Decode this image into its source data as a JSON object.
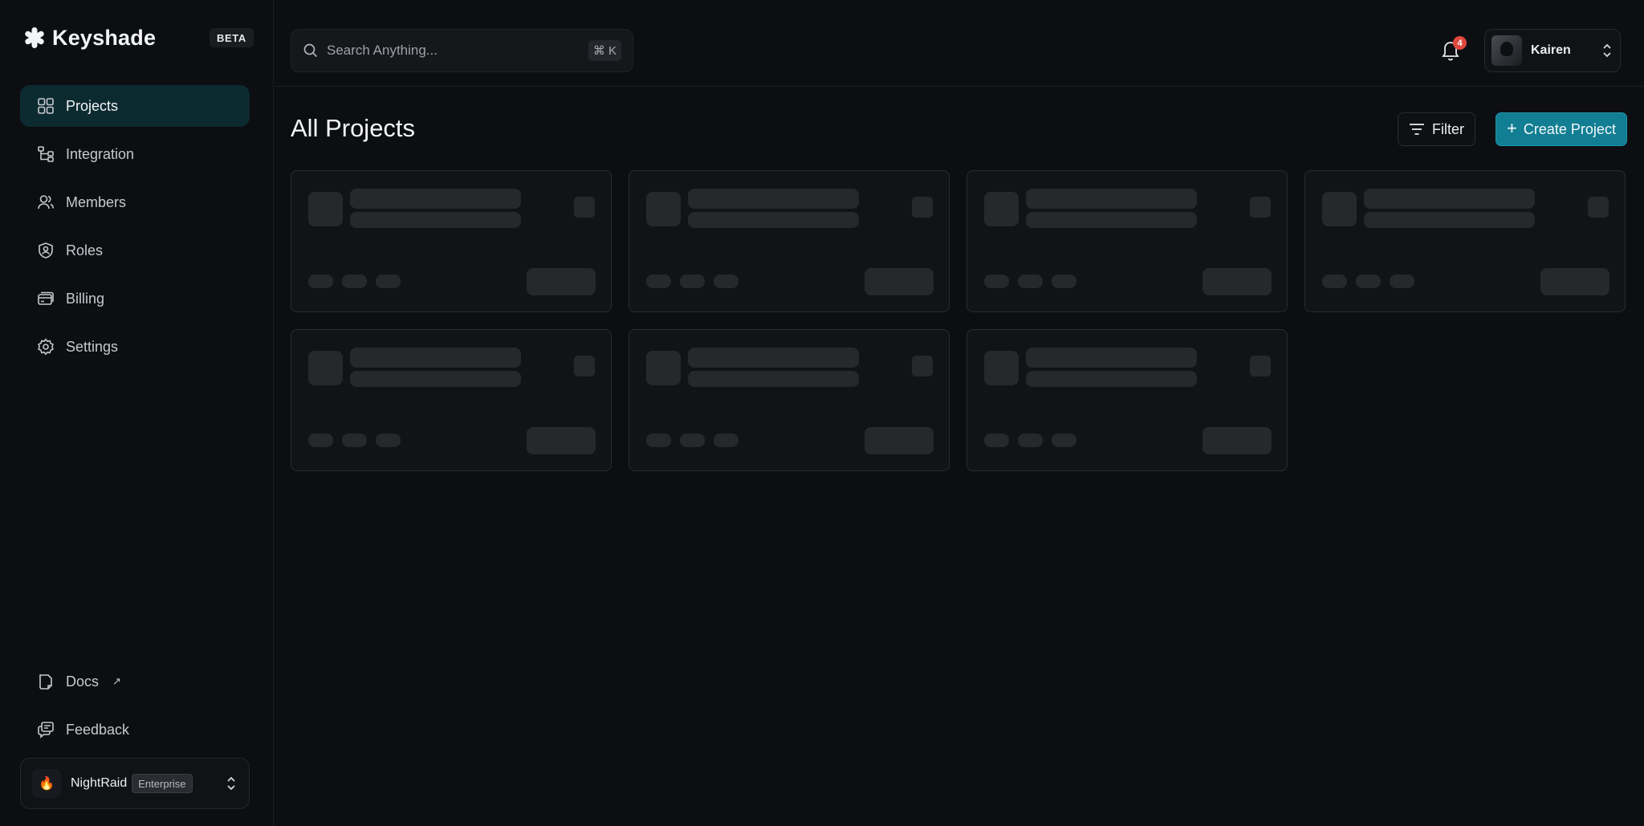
{
  "brand": {
    "name": "Keyshade",
    "badge": "BETA"
  },
  "sidebar": {
    "items": [
      {
        "label": "Projects",
        "icon": "grid-icon",
        "active": true
      },
      {
        "label": "Integration",
        "icon": "integration-icon",
        "active": false
      },
      {
        "label": "Members",
        "icon": "members-icon",
        "active": false
      },
      {
        "label": "Roles",
        "icon": "roles-icon",
        "active": false
      },
      {
        "label": "Billing",
        "icon": "billing-icon",
        "active": false
      },
      {
        "label": "Settings",
        "icon": "gear-icon",
        "active": false
      }
    ],
    "bottom_items": [
      {
        "label": "Docs",
        "icon": "docs-icon",
        "external_mark": "↗"
      },
      {
        "label": "Feedback",
        "icon": "feedback-icon"
      }
    ],
    "workspace": {
      "name": "NightRaid",
      "plan": "Enterprise",
      "logo": "🔥"
    }
  },
  "topbar": {
    "search": {
      "placeholder": "Search Anything...",
      "shortcut": "⌘ K"
    },
    "notifications": {
      "count": "4"
    },
    "user": {
      "name": "Kairen"
    }
  },
  "main": {
    "title": "All Projects",
    "filter_label": "Filter",
    "create_label": "Create Project",
    "skeleton_cards": 7
  },
  "colors": {
    "background": "#0d0e12",
    "active_nav": "#0c2b31",
    "accent": "#127e93",
    "badge": "#e0483e",
    "skeleton": "#27282c"
  }
}
